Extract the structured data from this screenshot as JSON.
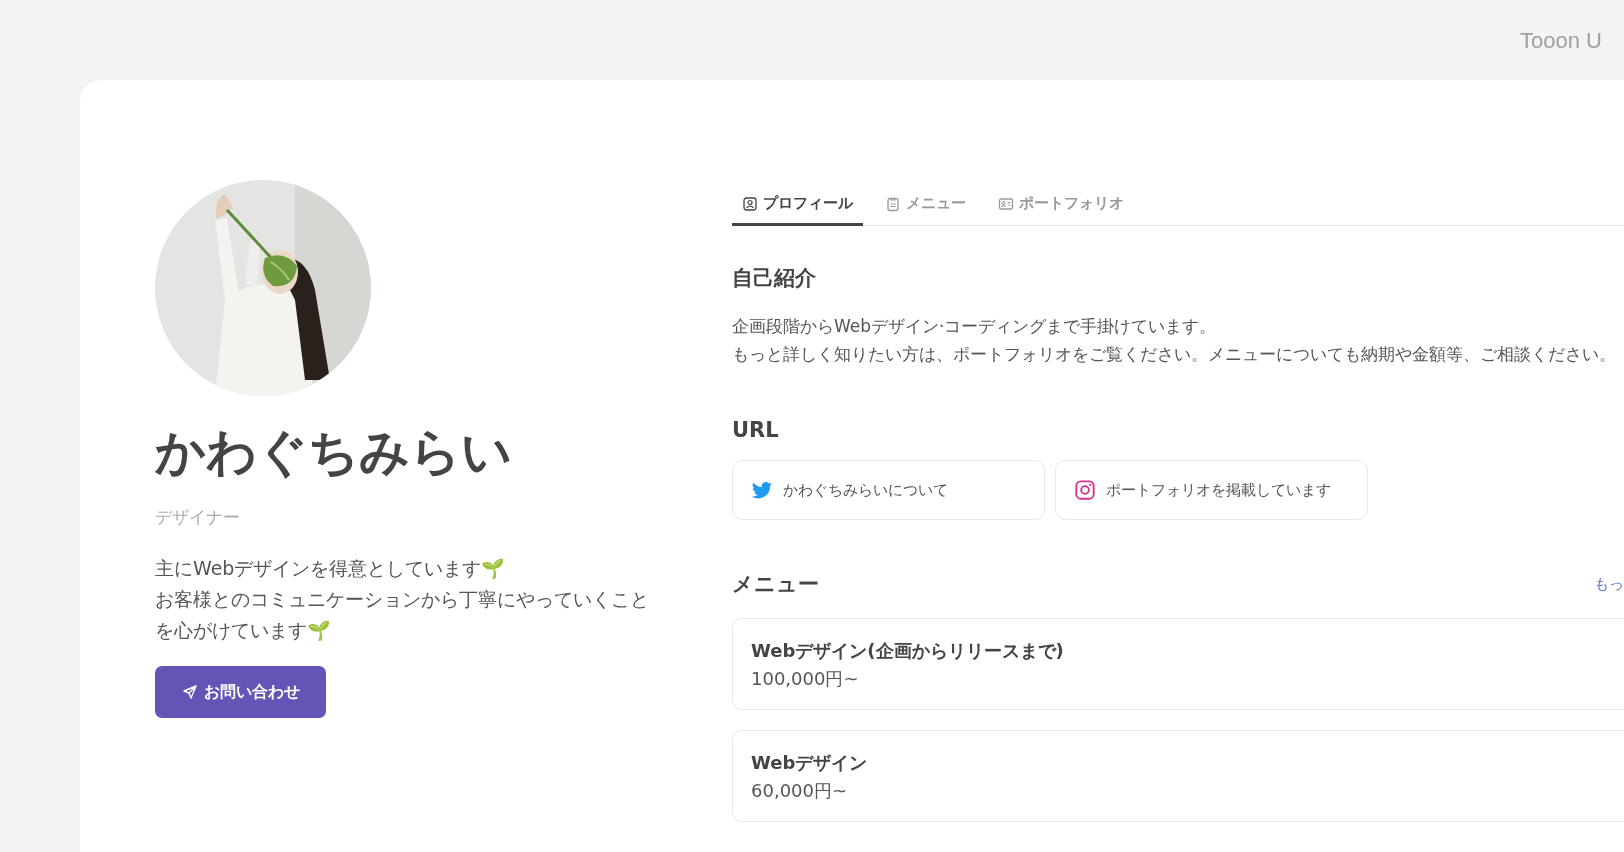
{
  "logo": "Tooon U",
  "profile": {
    "name": "かわぐちみらい",
    "role": "デザイナー",
    "bio": [
      "主にWebデザインを得意としています🌱",
      "お客様とのコミュニケーションから丁寧にやっていくこと",
      "を心がけています🌱"
    ],
    "contact_button": "お問い合わせ"
  },
  "tabs": [
    {
      "label": "プロフィール",
      "kind": "person",
      "selected": true
    },
    {
      "label": "メニュー",
      "kind": "clipboard",
      "selected": false
    },
    {
      "label": "ポートフォリオ",
      "kind": "card",
      "selected": false
    }
  ],
  "intro": {
    "heading": "自己紹介",
    "lines": [
      "企画段階からWebデザイン·コーディングまで手掛けています。",
      "もっと詳しく知りたい方は、ポートフォリオをご覧ください。メニューについても納期や金額等、ご相談ください。"
    ]
  },
  "urls": {
    "heading": "URL",
    "links": [
      {
        "kind": "twitter",
        "label": "かわぐちみらいについて"
      },
      {
        "kind": "instagram",
        "label": "ポートフォリオを掲載しています"
      }
    ]
  },
  "menu": {
    "heading": "メニュー",
    "more_link": "もっ",
    "items": [
      {
        "title": "Webデザイン(企画からリリースまで)",
        "price": "100,000円~"
      },
      {
        "title": "Webデザイン",
        "price": "60,000円~"
      }
    ]
  }
}
